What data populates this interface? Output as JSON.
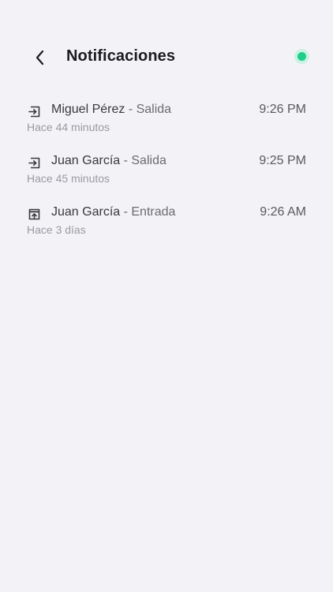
{
  "header": {
    "title": "Notificaciones",
    "status_color": "#1fce8a"
  },
  "notifications": [
    {
      "name": "Miguel Pérez",
      "action": "- Salida",
      "time": "9:26 PM",
      "relative": "Hace 44 minutos",
      "icon": "exit-icon"
    },
    {
      "name": "Juan García",
      "action": "- Salida",
      "time": "9:25 PM",
      "relative": "Hace 45 minutos",
      "icon": "exit-icon"
    },
    {
      "name": "Juan García",
      "action": "- Entrada",
      "time": "9:26 AM",
      "relative": "Hace 3 días",
      "icon": "entry-icon"
    }
  ]
}
